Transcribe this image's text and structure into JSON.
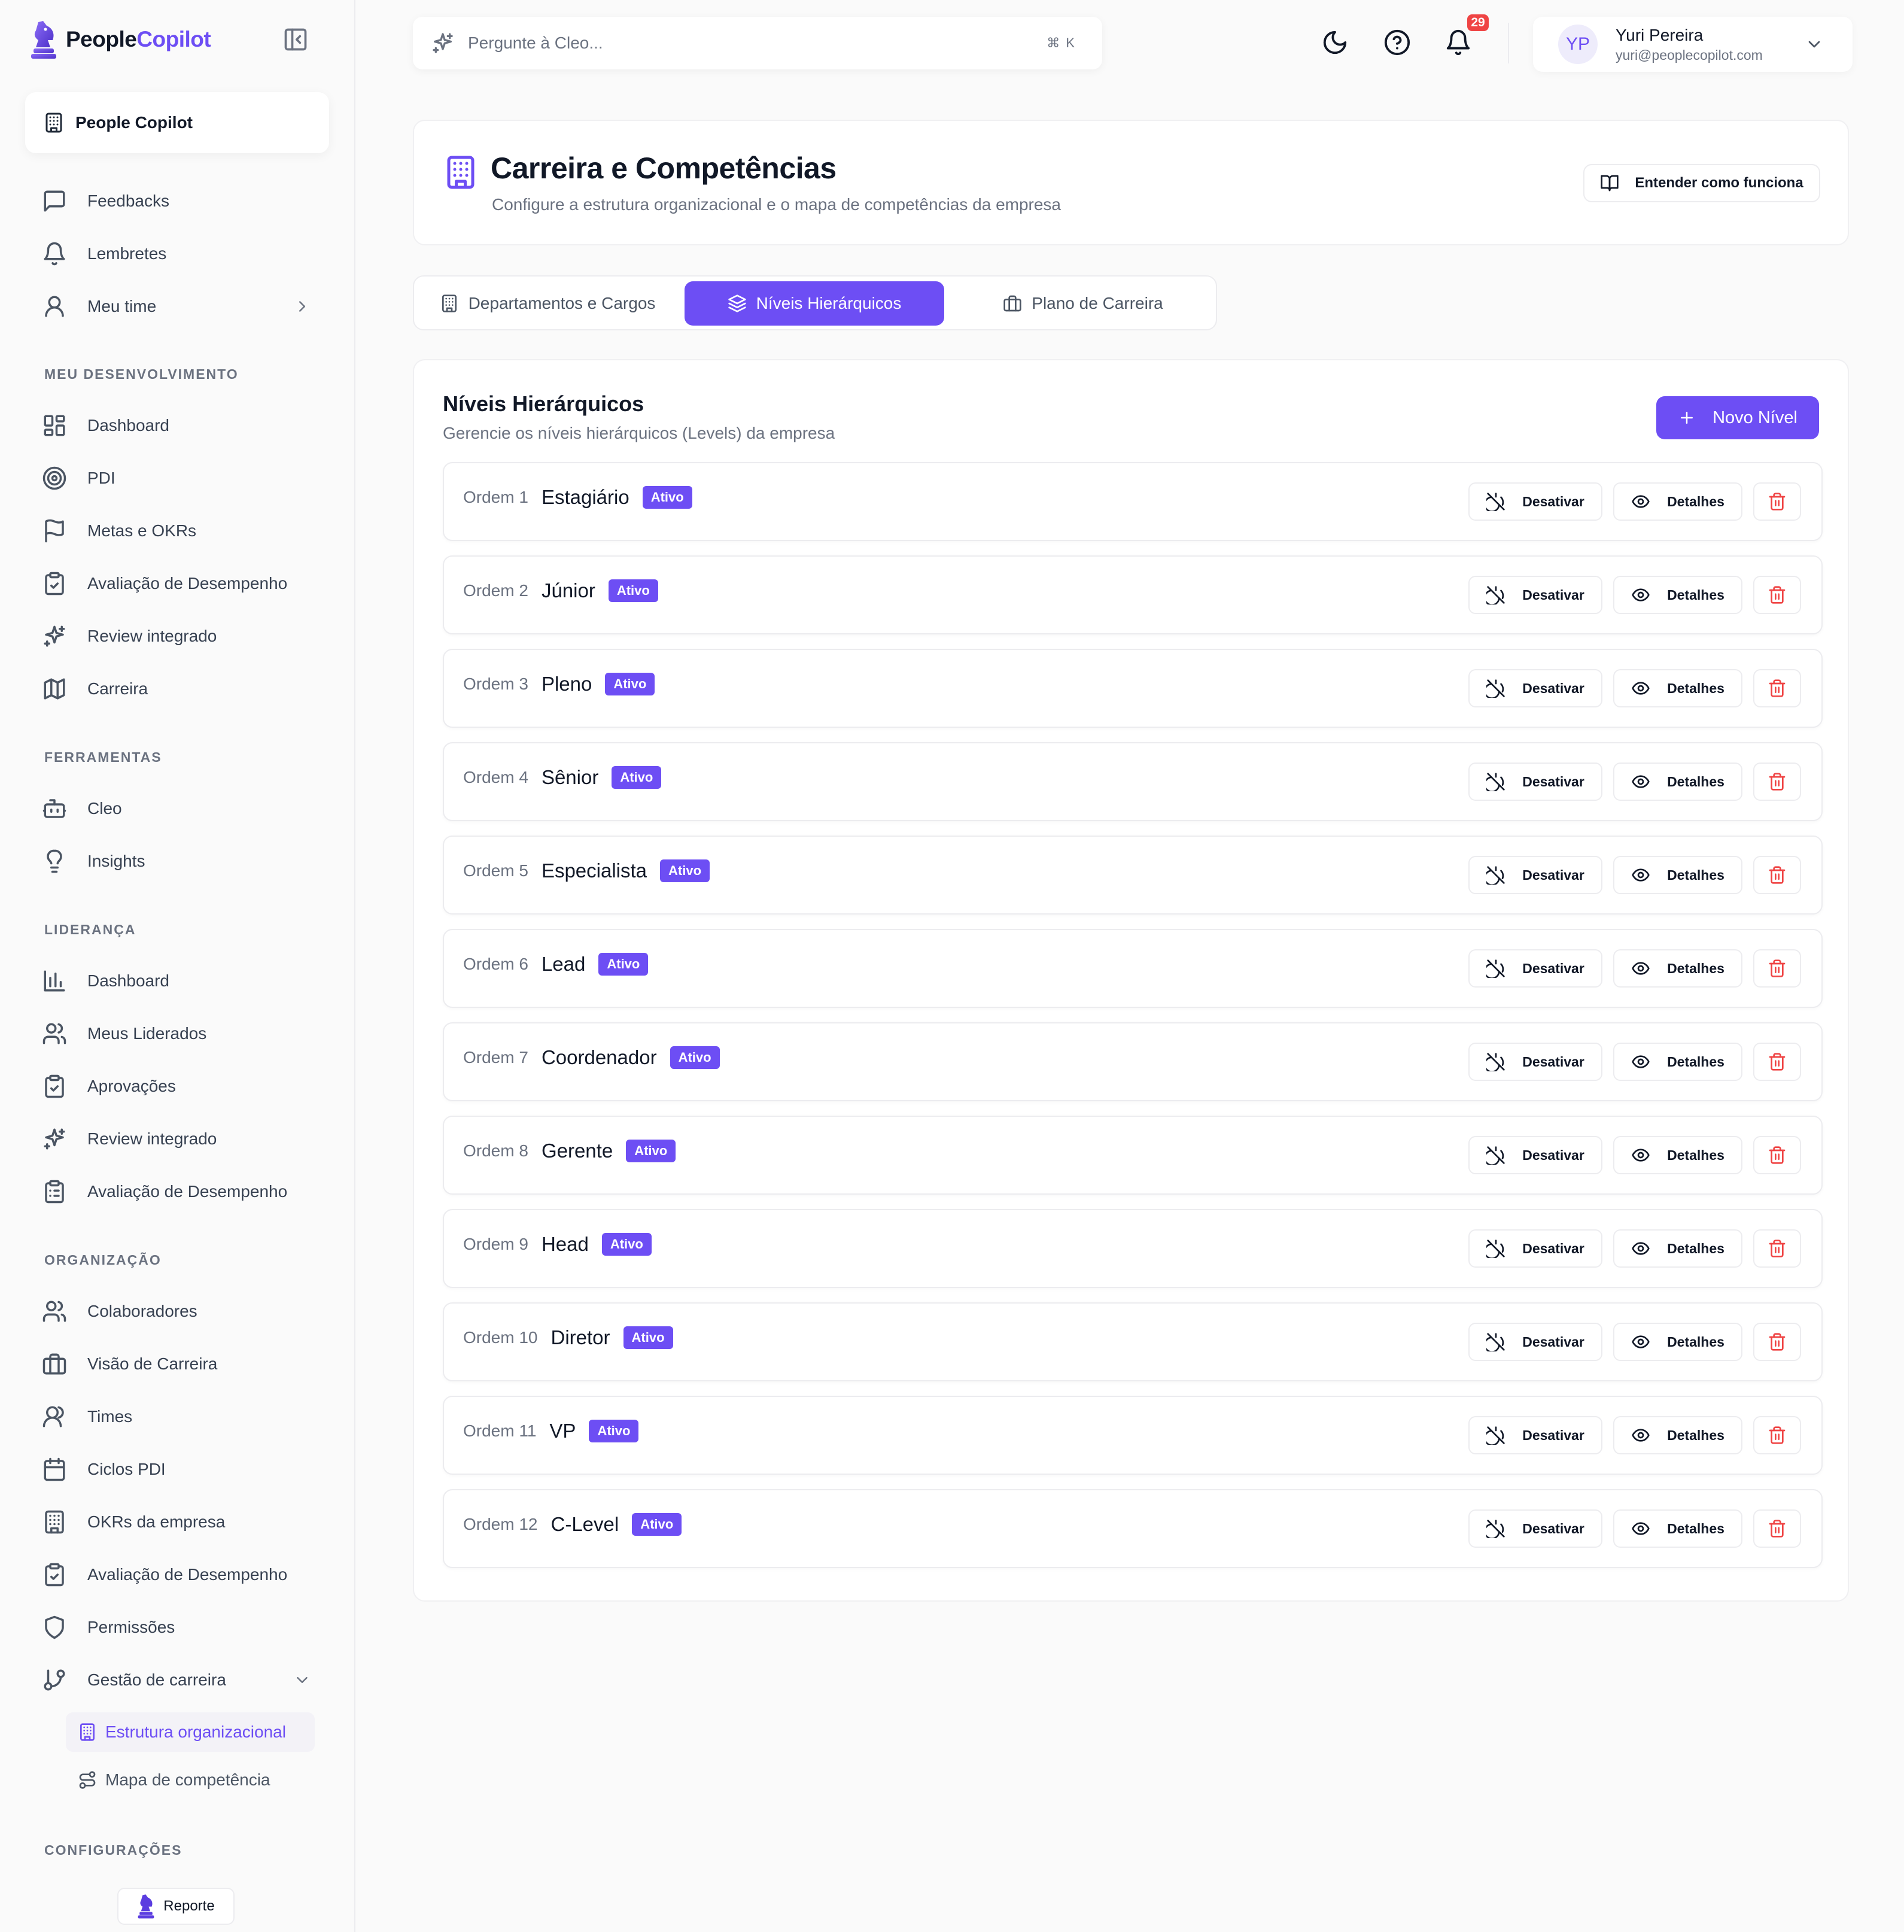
{
  "brand": {
    "name_part1": "People",
    "name_part2": "Copilot"
  },
  "workspace": {
    "label": "People Copilot"
  },
  "sidebar": {
    "top_items": [
      {
        "label": "Feedbacks",
        "icon": "message-square-icon"
      },
      {
        "label": "Lembretes",
        "icon": "bell-icon"
      },
      {
        "label": "Meu time",
        "icon": "user-icon"
      }
    ],
    "sections": [
      {
        "label": "MEU DESENVOLVIMENTO",
        "items": [
          {
            "label": "Dashboard",
            "icon": "layout-dashboard-icon"
          },
          {
            "label": "PDI",
            "icon": "target-icon"
          },
          {
            "label": "Metas e OKRs",
            "icon": "flag-icon"
          },
          {
            "label": "Avaliação de Desempenho",
            "icon": "clipboard-check-icon"
          },
          {
            "label": "Review integrado",
            "icon": "sparkles-icon"
          },
          {
            "label": "Carreira",
            "icon": "map-icon"
          }
        ]
      },
      {
        "label": "FERRAMENTAS",
        "items": [
          {
            "label": "Cleo",
            "icon": "bot-icon"
          },
          {
            "label": "Insights",
            "icon": "lightbulb-icon"
          }
        ]
      },
      {
        "label": "LIDERANÇA",
        "items": [
          {
            "label": "Dashboard",
            "icon": "bar-chart-icon"
          },
          {
            "label": "Meus Liderados",
            "icon": "users-icon"
          },
          {
            "label": "Aprovações",
            "icon": "clipboard-check-icon"
          },
          {
            "label": "Review integrado",
            "icon": "sparkles-icon"
          },
          {
            "label": "Avaliação de Desempenho",
            "icon": "clipboard-list-icon"
          }
        ]
      },
      {
        "label": "ORGANIZAÇÃO",
        "items": [
          {
            "label": "Colaboradores",
            "icon": "users-icon"
          },
          {
            "label": "Visão de Carreira",
            "icon": "briefcase-icon"
          },
          {
            "label": "Times",
            "icon": "users-round-icon"
          },
          {
            "label": "Ciclos PDI",
            "icon": "calendar-icon"
          },
          {
            "label": "OKRs da empresa",
            "icon": "building-icon"
          },
          {
            "label": "Avaliação de Desempenho",
            "icon": "clipboard-check-icon"
          },
          {
            "label": "Permissões",
            "icon": "shield-icon"
          },
          {
            "label": "Gestão de carreira",
            "icon": "git-branch-icon"
          }
        ]
      }
    ],
    "sub_items": [
      {
        "label": "Estrutura organizacional",
        "icon": "building-icon",
        "active": true
      },
      {
        "label": "Mapa de competência",
        "icon": "route-icon",
        "active": false
      }
    ],
    "settings_label": "CONFIGURAÇÕES",
    "report_label": "Reporte"
  },
  "topbar": {
    "search_placeholder": "Pergunte à Cleo...",
    "search_shortcut": "⌘ K",
    "notifications_count": "29",
    "user": {
      "initials": "YP",
      "name": "Yuri Pereira",
      "email": "yuri@peoplecopilot.com"
    }
  },
  "header": {
    "title": "Carreira e Competências",
    "subtitle": "Configure a estrutura organizacional e o mapa de competências da empresa",
    "how_button": "Entender como funciona"
  },
  "tabs": [
    {
      "label": "Departamentos e Cargos",
      "icon": "building-icon",
      "active": false
    },
    {
      "label": "Níveis Hierárquicos",
      "icon": "layers-icon",
      "active": true
    },
    {
      "label": "Plano de Carreira",
      "icon": "briefcase-icon",
      "active": false
    }
  ],
  "levels": {
    "title": "Níveis Hierárquicos",
    "subtitle": "Gerencie os níveis hierárquicos (Levels) da empresa",
    "new_button": "Novo Nível",
    "deactivate_label": "Desativar",
    "details_label": "Detalhes",
    "items": [
      {
        "order": "Ordem 1",
        "name": "Estagiário",
        "status": "Ativo"
      },
      {
        "order": "Ordem 2",
        "name": "Júnior",
        "status": "Ativo"
      },
      {
        "order": "Ordem 3",
        "name": "Pleno",
        "status": "Ativo"
      },
      {
        "order": "Ordem 4",
        "name": "Sênior",
        "status": "Ativo"
      },
      {
        "order": "Ordem 5",
        "name": "Especialista",
        "status": "Ativo"
      },
      {
        "order": "Ordem 6",
        "name": "Lead",
        "status": "Ativo"
      },
      {
        "order": "Ordem 7",
        "name": "Coordenador",
        "status": "Ativo"
      },
      {
        "order": "Ordem 8",
        "name": "Gerente",
        "status": "Ativo"
      },
      {
        "order": "Ordem 9",
        "name": "Head",
        "status": "Ativo"
      },
      {
        "order": "Ordem 10",
        "name": "Diretor",
        "status": "Ativo"
      },
      {
        "order": "Ordem 11",
        "name": "VP",
        "status": "Ativo"
      },
      {
        "order": "Ordem 12",
        "name": "C-Level",
        "status": "Ativo"
      }
    ]
  },
  "colors": {
    "accent": "#6d4ef4",
    "danger": "#ef4444"
  }
}
